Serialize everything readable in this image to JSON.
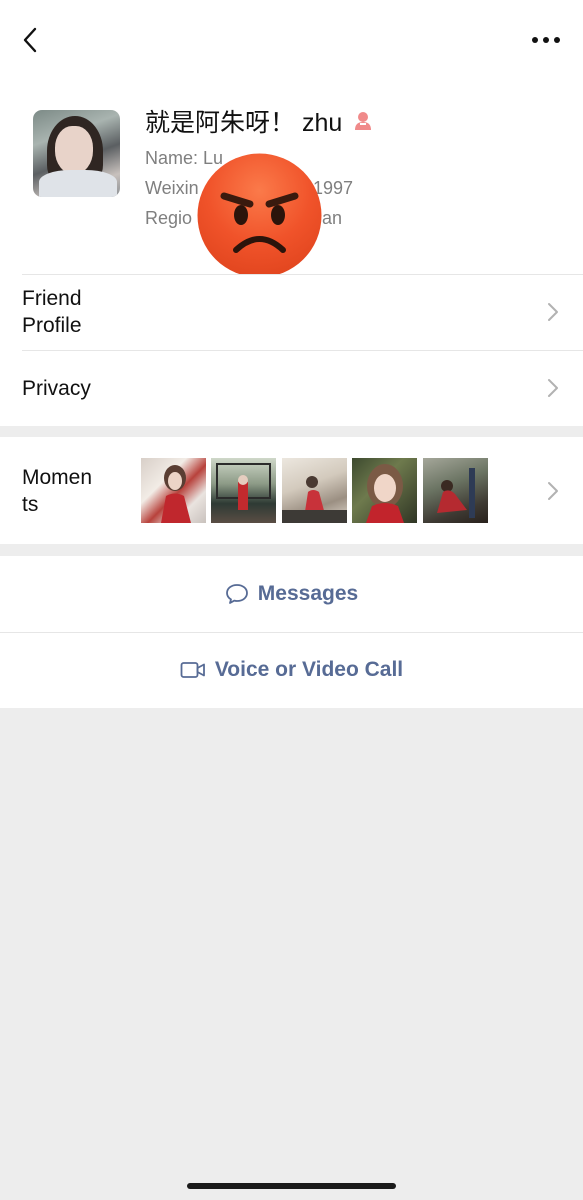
{
  "header": {
    "back_icon": "chevron-left-icon",
    "more_icon": "more-horizontal-icon"
  },
  "profile": {
    "nickname": "就是阿朱呀！ zhu",
    "gender_icon": "female-gender-icon",
    "gender_color": "#f08a8a",
    "name_line": "Name: Lu",
    "weixin_line_left": "Weixin",
    "weixin_line_right": "1997",
    "region_line_left": "Regio",
    "region_line_right": "an",
    "overlay_emoji": "angry-face-emoji"
  },
  "rows": {
    "friend_profile": [
      "Friend",
      "Profile"
    ],
    "privacy": "Privacy",
    "moments": [
      "Momen",
      "ts"
    ]
  },
  "actions": {
    "messages": "Messages",
    "messages_icon": "chat-bubble-icon",
    "call": "Voice or Video Call",
    "call_icon": "video-camera-icon",
    "link_color": "#576b95"
  }
}
